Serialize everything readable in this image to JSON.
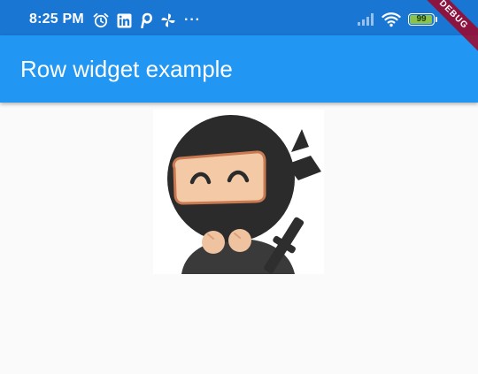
{
  "status_bar": {
    "time": "8:25 PM",
    "overflow_indicator": "···",
    "battery_level": "99",
    "battery_fraction": 0.99,
    "icons_left": [
      "alarm-icon",
      "linkedin-icon",
      "pinterest-icon",
      "pinwheel-icon"
    ],
    "icons_right": [
      "signal-icon",
      "wifi-icon",
      "battery-icon"
    ]
  },
  "app_bar": {
    "title": "Row widget example",
    "color": "#2196f3"
  },
  "content": {
    "image": "ninja-mascot-image"
  },
  "debug_banner": {
    "label": "DEBUG"
  }
}
